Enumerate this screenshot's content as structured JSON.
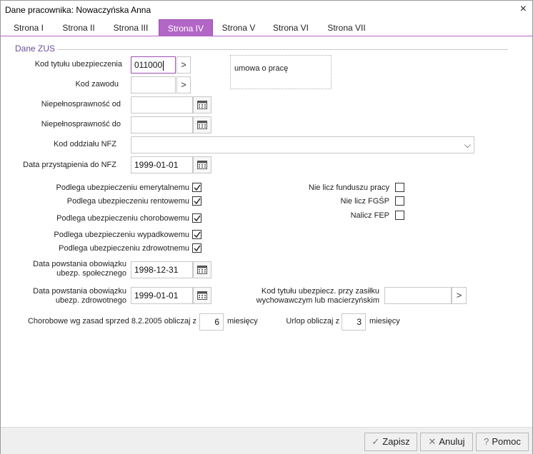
{
  "window": {
    "title": "Dane pracownika: Nowaczyńska Anna",
    "close_icon": "×"
  },
  "tabs": [
    {
      "label": "Strona I"
    },
    {
      "label": "Strona II"
    },
    {
      "label": "Strona III"
    },
    {
      "label": "Strona IV",
      "active": true
    },
    {
      "label": "Strona V"
    },
    {
      "label": "Strona VI"
    },
    {
      "label": "Strona VII"
    }
  ],
  "group": {
    "label": "Dane ZUS"
  },
  "fields": {
    "kod_tytulu": {
      "label": "Kod tytułu ubezpieczenia",
      "value": "011000",
      "desc": "umowa o pracę"
    },
    "kod_zawodu": {
      "label": "Kod zawodu",
      "value": ""
    },
    "niepelno_od": {
      "label": "Niepełnosprawność od",
      "value": ""
    },
    "niepelno_do": {
      "label": "Niepełnosprawność do",
      "value": ""
    },
    "kod_nfz": {
      "label": "Kod oddziału NFZ",
      "value": ""
    },
    "data_nfz": {
      "label": "Data przystąpienia do NFZ",
      "value": "1999-01-01"
    },
    "data_spol": {
      "label": "Data powstania obowiązku ubezp. społecznego",
      "value": "1998-12-31"
    },
    "data_zdrow": {
      "label": "Data powstania obowiązku ubezp. zdrowotnego",
      "value": "1999-01-01"
    },
    "kod_zasilek": {
      "label": "Kod tytułu ubezpiecz. przy zasiłku wychowawczym lub macierzyńskim",
      "value": ""
    }
  },
  "checkboxes_left": [
    {
      "label": "Podlega ubezpieczeniu emerytalnemu",
      "checked": true
    },
    {
      "label": "Podlega ubezpieczeniu rentowemu",
      "checked": true
    },
    {
      "label": "Podlega ubezpieczeniu chorobowemu",
      "checked": true
    },
    {
      "label": "Podlega ubezpieczeniu wypadkowemu",
      "checked": true
    },
    {
      "label": "Podlega ubezpieczeniu zdrowotnemu",
      "checked": true
    }
  ],
  "checkboxes_right": [
    {
      "label": "Nie licz funduszu pracy",
      "checked": false
    },
    {
      "label": "Nie licz FGŚP",
      "checked": false
    },
    {
      "label": "Nalicz FEP",
      "checked": false
    }
  ],
  "chorobowe": {
    "label": "Chorobowe wg zasad sprzed 8.2.2005 obliczaj z",
    "value": "6",
    "unit": "miesięcy"
  },
  "urlop": {
    "label": "Urlop obliczaj z",
    "value": "3",
    "unit": "miesięcy"
  },
  "buttons": {
    "arrow": ">",
    "dropdown": "⌵",
    "zapisz": "Zapisz",
    "zapisz_icon": "✓",
    "anuluj": "Anuluj",
    "anuluj_icon": "✕",
    "pomoc": "Pomoc",
    "pomoc_icon": "?"
  }
}
